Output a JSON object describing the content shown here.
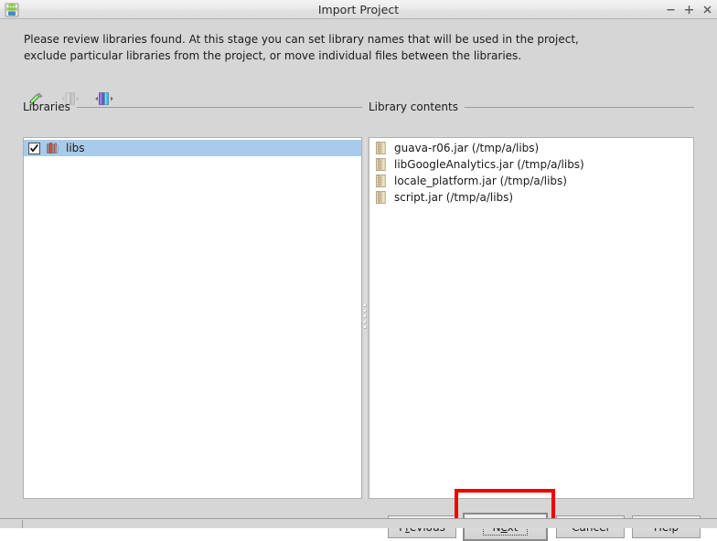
{
  "window": {
    "title": "Import Project",
    "app_icon": "android-robot-icon",
    "controls": {
      "minimize": "minimize-icon",
      "maximize": "maximize-icon",
      "close": "close-icon"
    }
  },
  "intro": {
    "line1": "Please review libraries found. At this stage you can set library names that will be used in the project,",
    "line2": "exclude particular libraries from the project, or move individual files between the libraries."
  },
  "toolbar": {
    "buttons": [
      {
        "name": "rename-library",
        "icon": "pencil-icon",
        "enabled": true
      },
      {
        "name": "merge-libraries",
        "icon": "merge-icon",
        "enabled": false
      },
      {
        "name": "split-library",
        "icon": "split-icon",
        "enabled": true
      }
    ]
  },
  "libraries_panel": {
    "header": "Libraries",
    "items": [
      {
        "label": "libs",
        "checked": true,
        "selected": true,
        "icon": "books-icon"
      }
    ]
  },
  "contents_panel": {
    "header": "Library contents",
    "items": [
      {
        "label": "guava-r06.jar (/tmp/a/libs)",
        "icon": "jar-icon"
      },
      {
        "label": "libGoogleAnalytics.jar (/tmp/a/libs)",
        "icon": "jar-icon"
      },
      {
        "label": "locale_platform.jar (/tmp/a/libs)",
        "icon": "jar-icon"
      },
      {
        "label": "script.jar (/tmp/a/libs)",
        "icon": "jar-icon"
      }
    ]
  },
  "buttons": {
    "previous": {
      "pre": "P",
      "mnemonic": "r",
      "post": "evious"
    },
    "next": {
      "pre": "N",
      "mnemonic": "e",
      "post": "xt"
    },
    "cancel": {
      "label": "Cancel"
    },
    "help": {
      "label": "Help"
    }
  },
  "highlight": {
    "target": "next-button",
    "color": "#ee0000"
  },
  "colors": {
    "window_bg": "#d6d6d6",
    "panel_bg": "#ffffff",
    "selection": "#a8cbec",
    "highlight": "#ee0000",
    "text": "#1a1a1a"
  }
}
